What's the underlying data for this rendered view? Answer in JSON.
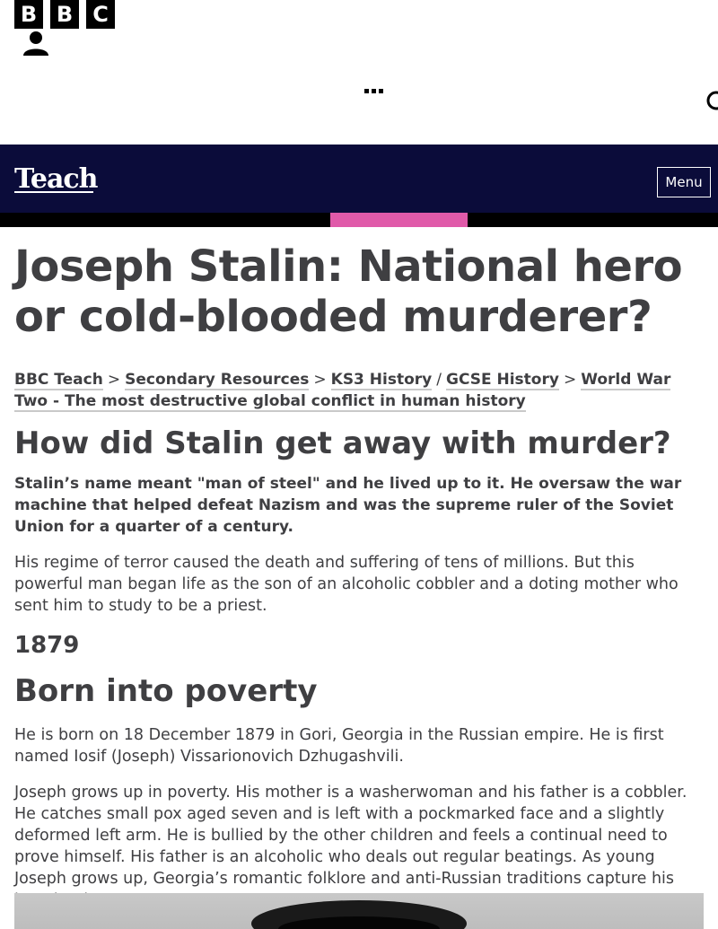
{
  "bbc": {
    "logo_letters": [
      "B",
      "B",
      "C"
    ]
  },
  "teach": {
    "logo": "Teach",
    "menu_label": "Menu"
  },
  "colors": {
    "teach_band": "#0b0c3a",
    "accent_pink": "#e05aa9",
    "text": "#3f3f42"
  },
  "page": {
    "title": "Joseph Stalin: National hero or cold-blooded murderer?",
    "breadcrumb": [
      {
        "label": "BBC Teach"
      },
      {
        "sep": ">"
      },
      {
        "label": "Secondary Resources"
      },
      {
        "sep": ">"
      },
      {
        "label": "KS3 History"
      },
      {
        "sep": "/"
      },
      {
        "label": "GCSE History"
      },
      {
        "sep": ">"
      },
      {
        "label": "World War Two - The most destructive global conflict in human history"
      }
    ],
    "section_title": "How did Stalin get away with murder?",
    "lead": "Stalin’s name meant \"man of steel\" and he lived up to it. He oversaw the war machine that helped defeat Nazism and was the supreme ruler of the Soviet Union for a quarter of a century.",
    "intro": "His regime of terror caused the death and suffering of tens of millions. But this powerful man began life as the son of an alcoholic cobbler and a doting mother who sent him to study to be a priest.",
    "year": "1879",
    "subhead": "Born into poverty",
    "para1": "He is born on 18 December 1879 in Gori, Georgia in the Russian empire. He is first named Iosif (Joseph) Vissarionovich Dzhugashvili.",
    "para2": "Joseph grows up in poverty. His mother is a washerwoman and his father is a cobbler. He catches small pox aged seven and is left with a pockmarked face and a slightly deformed left arm. He is bullied by the other children and feels a continual need to prove himself. His father is an alcoholic who deals out regular beatings. As young Joseph grows up, Georgia’s romantic folklore and anti-Russian traditions capture his imagination."
  }
}
